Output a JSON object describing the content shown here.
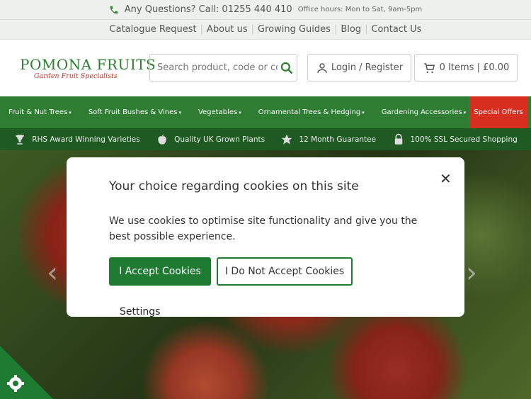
{
  "topbar": {
    "question": "Any Questions? Call: 01255 440 410",
    "hours": "Office hours: Mon to Sat, 9am-5pm"
  },
  "links": [
    "Catalogue Request",
    "About us",
    "Growing Guides",
    "Blog",
    "Contact Us"
  ],
  "logo": {
    "brand": "POMONA FRUITS",
    "tagline": "Garden Fruit Specialists"
  },
  "search": {
    "placeholder": "Search product, code or cc"
  },
  "login_label": "Login / Register",
  "cart_label": "0 Items | £0.00",
  "nav": {
    "items": [
      "Fruit & Nut Trees",
      "Soft Fruit Bushes & Vines",
      "Vegetables",
      "Ornamental Trees & Hedging",
      "Gardening Accessories"
    ],
    "special": "Special Offers"
  },
  "trust": [
    "RHS Award Winning Varieties",
    "Quality UK Grown Plants",
    "12 Month Guarantee",
    "100% SSL Secured Shopping"
  ],
  "cookie": {
    "title": "Your choice regarding cookies on this site",
    "body": "We use cookies to optimise site functionality and give you the best possible experience.",
    "accept": "I Accept Cookies",
    "decline": "I Do Not Accept Cookies",
    "settings": "Settings"
  },
  "colors": {
    "green": "#2e7d32",
    "dark_green": "#1f5a23",
    "red": "#d62f1f"
  }
}
